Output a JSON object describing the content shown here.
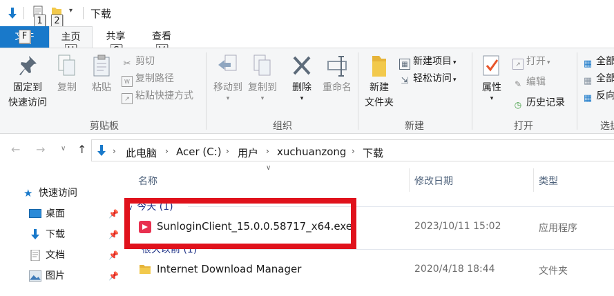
{
  "quick_access_toolbar": {
    "title": "下载",
    "keytips": [
      "1",
      "2"
    ]
  },
  "tabs": {
    "file": "文件",
    "home": "主页",
    "share": "共享",
    "view": "查看",
    "keytips": {
      "file": "F",
      "home": "H",
      "share": "S",
      "view": "V"
    }
  },
  "ribbon": {
    "clipboard": {
      "pin_line1": "固定到",
      "pin_line2": "快速访问",
      "copy": "复制",
      "paste": "粘贴",
      "cut": "剪切",
      "copy_path": "复制路径",
      "paste_shortcut": "粘贴快捷方式",
      "group_label": "剪贴板"
    },
    "organize": {
      "move_to": "移动到",
      "copy_to": "复制到",
      "delete": "删除",
      "rename": "重命名",
      "group_label": "组织"
    },
    "new": {
      "new_folder_line1": "新建",
      "new_folder_line2": "文件夹",
      "new_item": "新建项目",
      "easy_access": "轻松访问",
      "group_label": "新建"
    },
    "open": {
      "properties": "属性",
      "open": "打开",
      "edit": "编辑",
      "history": "历史记录",
      "group_label": "打开"
    },
    "select": {
      "select_all": "全部",
      "select_none": "全部",
      "invert": "反向",
      "group_label": "选护"
    }
  },
  "address_bar": {
    "crumbs": [
      "此电脑",
      "Acer (C:)",
      "用户",
      "xuchuanzong",
      "下载"
    ]
  },
  "nav_pane": {
    "quick_access": "快速访问",
    "items": [
      {
        "label": "桌面"
      },
      {
        "label": "下载"
      },
      {
        "label": "文档"
      },
      {
        "label": "图片"
      }
    ]
  },
  "file_list": {
    "columns": {
      "name": "名称",
      "modified": "修改日期",
      "type": "类型"
    },
    "groups": [
      {
        "header": "今天 (1)",
        "rows": [
          {
            "name": "SunloginClient_15.0.0.58717_x64.exe",
            "modified": "2023/10/11 15:02",
            "type": "应用程序"
          }
        ]
      },
      {
        "header": "很久以前 (1)",
        "rows": [
          {
            "name": "Internet Download Manager",
            "modified": "2020/4/18 18:44",
            "type": "文件夹"
          }
        ]
      }
    ]
  },
  "colors": {
    "accent": "#1979ca",
    "highlight_box": "#e0121c",
    "folder": "#f2c94c"
  }
}
